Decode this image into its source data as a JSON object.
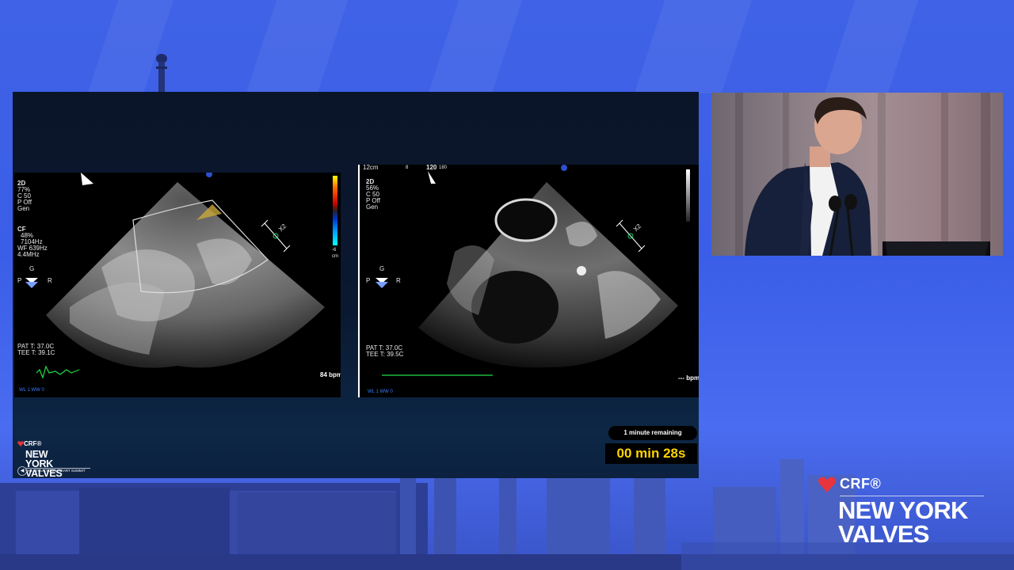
{
  "slide": {
    "left_echo": {
      "mode": "2D",
      "params": [
        "77%",
        "C 50",
        "P Off",
        "Gen"
      ],
      "cf_label": "CF",
      "cf_params": [
        "48%",
        "7104Hz",
        "WF 639Hz",
        "4.4MHz"
      ],
      "orientation": {
        "g": "G",
        "p": "P",
        "r": "R"
      },
      "temps": [
        "PAT T: 37.0C",
        "TEE T: 39.1C"
      ],
      "bpm": "84 bpm",
      "wl": "WL 1  WW 0",
      "angle": "X2",
      "scale_unit": "-6\ncm"
    },
    "right_echo": {
      "depth": "12cm",
      "frame": "8",
      "angle_value": "120",
      "angle_max": "180",
      "mode": "2D",
      "params": [
        "56%",
        "C 50",
        "P Off",
        "Gen"
      ],
      "orientation": {
        "g": "G",
        "p": "P",
        "r": "R"
      },
      "temps": [
        "PAT T: 37.0C",
        "TEE T: 39.5C"
      ],
      "bpm": "--- bpm",
      "wl": "WL 1  WW 0",
      "angle": "X2"
    },
    "timer": {
      "label": "1 minute remaining",
      "value": "00 min 28s"
    },
    "small_logo": {
      "crf": "CRF®",
      "line1": "NEW YORK",
      "line2": "VALVES",
      "tagline": "THE STRUCTURAL HEART SUMMIT"
    }
  },
  "branding": {
    "crf": "CRF®",
    "line1": "NEW YORK",
    "line2": "VALVES",
    "heart_color": "#e8343c"
  },
  "colors": {
    "background": "#3f62e6",
    "timer_text": "#ffd400",
    "ecg_green": "#22dd44"
  }
}
